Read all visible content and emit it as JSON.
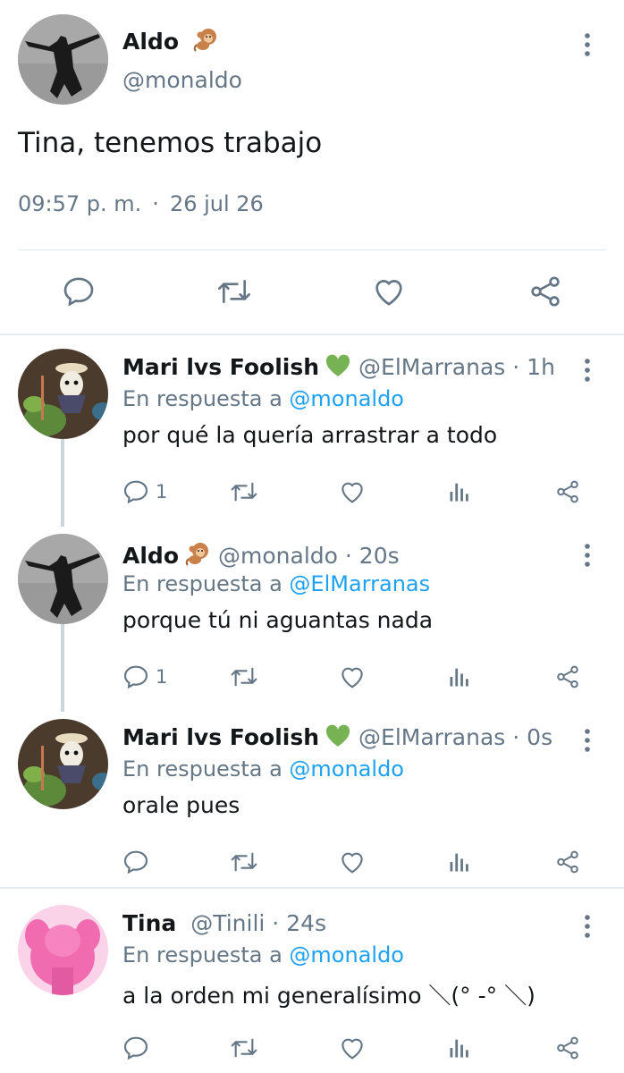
{
  "main_tweet": {
    "author_name": "Aldo",
    "author_emoji": "monkey-icon",
    "handle": "@monaldo",
    "text": "Tina, tenemos trabajo",
    "time": "09:57 p. m.",
    "separator": "·",
    "date": "26 jul 26",
    "actions": [
      "reply-icon",
      "retweet-icon",
      "like-icon",
      "share-icon"
    ]
  },
  "replies": [
    {
      "name": "Mari lvs Foolish",
      "badge": "green-heart-icon",
      "handle": "@ElMarranas",
      "sep": "·",
      "time": "1h",
      "replying_prefix": "En respuesta a",
      "replying_to": "@monaldo",
      "text": "por qué la quería arrastrar a todo",
      "reply_count": "1"
    },
    {
      "name": "Aldo",
      "badge": "monkey-icon",
      "handle": "@monaldo",
      "sep": "·",
      "time": "20s",
      "replying_prefix": "En respuesta a",
      "replying_to": "@ElMarranas",
      "text": "porque tú ni aguantas nada",
      "reply_count": "1"
    },
    {
      "name": "Mari lvs Foolish",
      "badge": "green-heart-icon",
      "handle": "@ElMarranas",
      "sep": "·",
      "time": "0s",
      "replying_prefix": "En respuesta a",
      "replying_to": "@monaldo",
      "text": "orale pues",
      "reply_count": ""
    },
    {
      "name": "Tina",
      "badge": "",
      "handle": "@Tinili",
      "sep": "·",
      "time": "24s",
      "replying_prefix": "En respuesta a",
      "replying_to": "@monaldo",
      "text": "a la orden mi generalísimo ＼(° -° ＼)",
      "reply_count": ""
    }
  ],
  "colors": {
    "text": "#14171a",
    "secondary": "#657786",
    "link": "#1da1f2",
    "heart": "#77b255",
    "tina_avatar": "#f06bb0",
    "divider": "#e6ecf0"
  }
}
